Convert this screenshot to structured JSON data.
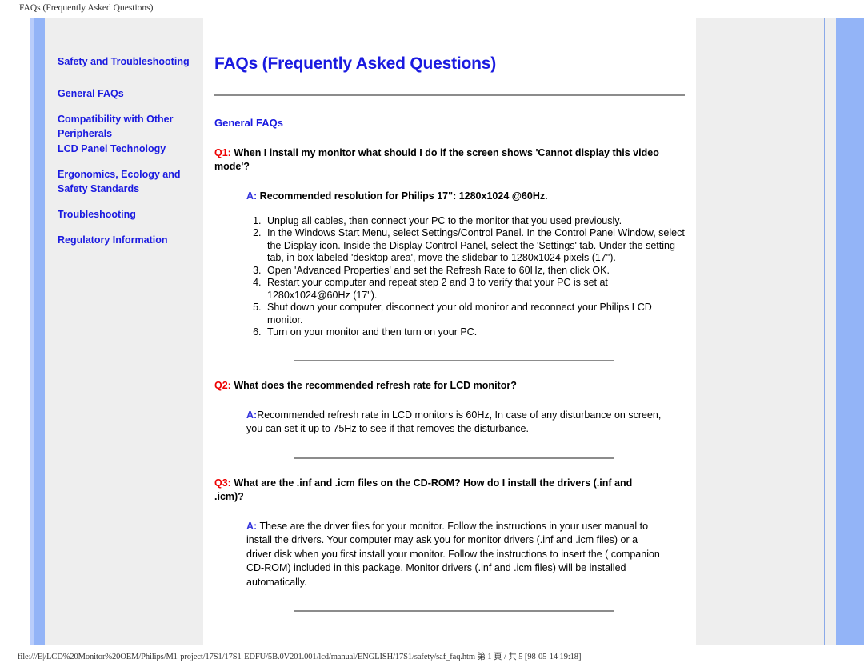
{
  "print": {
    "header": "FAQs (Frequently Asked Questions)",
    "footer": "file:///E|/LCD%20Monitor%20OEM/Philips/M1-project/17S1/17S1-EDFU/5B.0V201.001/lcd/manual/ENGLISH/17S1/safety/saf_faq.htm 第 1 頁 / 共 5 [98-05-14 19:18]"
  },
  "colors": {
    "link_blue": "#1a1ae0",
    "q_red": "#ee0000",
    "a_blue": "#3333dd",
    "accent_bar": "#93b4f7",
    "panel_gray": "#eeeeee",
    "rule_gray": "#8c8c8c"
  },
  "sidebar": {
    "items": [
      {
        "label": "Safety and Troubleshooting"
      },
      {
        "label": "General FAQs"
      },
      {
        "label": "Compatibility with Other Peripherals"
      },
      {
        "label": "LCD Panel Technology"
      },
      {
        "label": "Ergonomics, Ecology and Safety Standards"
      },
      {
        "label": "Troubleshooting"
      },
      {
        "label": "Regulatory Information"
      }
    ]
  },
  "main": {
    "title": "FAQs (Frequently Asked Questions)",
    "section_title": "General FAQs",
    "faqs": [
      {
        "q_label": "Q1:",
        "question": " When I install my monitor what should I do if the screen shows 'Cannot display this video mode'?",
        "a_label": "A:",
        "answer": " Recommended resolution for Philips 17\": 1280x1024 @60Hz.",
        "answer_bold": true,
        "steps": [
          "Unplug all cables, then connect your PC to the monitor that you used previously.",
          "In the Windows Start Menu, select Settings/Control Panel. In the Control Panel Window, select the Display icon. Inside the Display Control Panel, select the 'Settings' tab. Under the setting tab, in box labeled 'desktop area', move the slidebar to 1280x1024 pixels (17\").",
          "Open 'Advanced Properties' and set the Refresh Rate to 60Hz, then click OK.",
          "Restart your computer and repeat step 2 and 3 to verify that your PC is set at 1280x1024@60Hz (17\").",
          "Shut down your computer, disconnect your old monitor and reconnect your Philips LCD monitor.",
          "Turn on your monitor and then turn on your PC."
        ]
      },
      {
        "q_label": "Q2:",
        "question": " What does the recommended refresh rate for LCD monitor?",
        "a_label": "A:",
        "answer": "Recommended refresh rate in LCD monitors is 60Hz, In case of any disturbance on screen, you can set it up to 75Hz to see if that removes the disturbance.",
        "answer_bold": false,
        "steps": []
      },
      {
        "q_label": "Q3:",
        "question": " What are the .inf and .icm files on the CD-ROM? How do I install the drivers (.inf and .icm)?",
        "a_label": "A:",
        "answer": " These are the driver files for your monitor. Follow the instructions in your user manual to install the drivers. Your computer may ask you for monitor drivers (.inf and .icm files) or a driver disk when you first install your monitor. Follow the instructions to insert the ( companion CD-ROM) included in this package. Monitor drivers (.inf and .icm files) will be installed automatically.",
        "answer_bold": false,
        "steps": []
      }
    ]
  }
}
